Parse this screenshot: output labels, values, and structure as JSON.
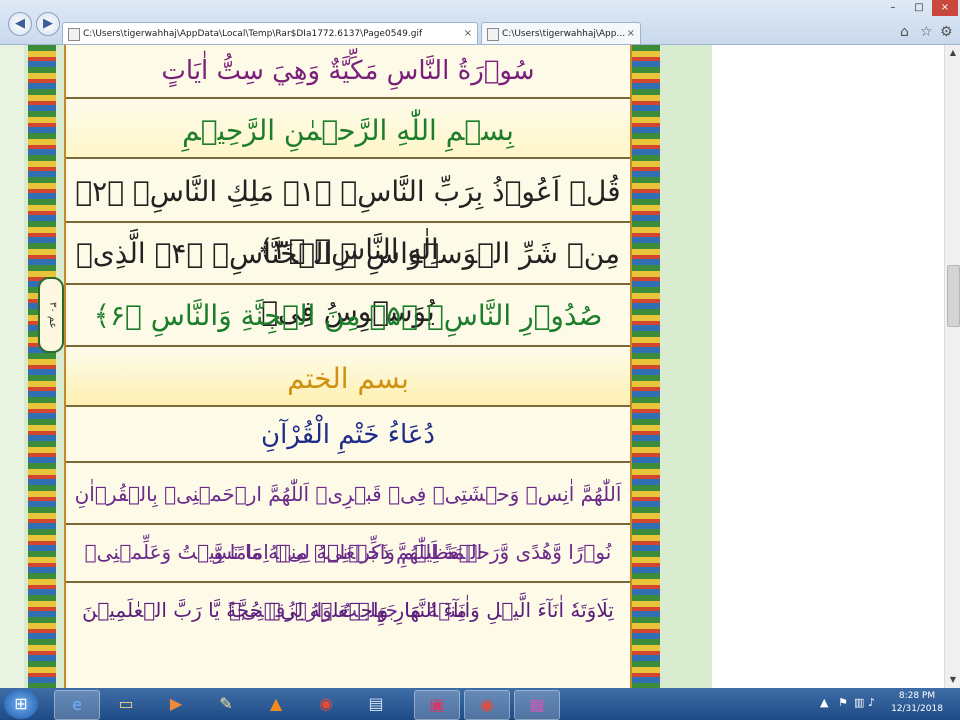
{
  "browser": {
    "back_icon": "back-arrow-icon",
    "forward_icon": "forward-arrow-icon",
    "tabs": [
      {
        "label": "C:\\Users\\tigerwahhaj\\AppData\\Local\\Temp\\Rar$DIa1772.6137\\Page0549.gif",
        "close": "×"
      },
      {
        "label": "C:\\Users\\tigerwahhaj\\App...",
        "close": "×"
      }
    ],
    "toolbar_icons": [
      "home-icon",
      "star-icon",
      "gear-icon"
    ],
    "window_controls": [
      "–",
      "□",
      "×"
    ]
  },
  "quran_page": {
    "surah_title": "سُوۡرَةُ النَّاسِ مَكِّيَّةٌ وَهِيَ سِتُّ اٰيَاتٍ",
    "bismillah": "بِسۡمِ اللّٰهِ الرَّحۡمٰنِ الرَّحِيۡمِ",
    "verses": [
      "قُلۡ اَعُوۡذُ بِرَبِّ النَّاسِۙ ﴿۱﴾ مَلِكِ النَّاسِۙ ﴿۲﴾ اِلٰهِ النَّاسِۙ ﴿۳﴾",
      "مِنۡ شَرِّ الۡوَسۡوَاسِ ۙ الۡخَنَّاسِۙ ﴿۴﴾ الَّذِىۡ يُوَسۡوِسُ فِىۡ",
      "صُدُوۡرِ النَّاسِۙ ﴿۵﴾ مِنَ الۡجِنَّةِ وَالنَّاسِ ﴿۶﴾"
    ],
    "khatm_label": "بسم الختم",
    "dua_title": "دُعَاءُ خَتْمِ الْقُرْآنِ",
    "dua_lines": [
      "اَللّٰهُمَّ اٰنِسۡ وَحۡشَتِىۡ فِىۡ قَبۡرِىۡ اَللّٰهُمَّ ارۡحَمۡنِىۡ بِالۡقُرۡاٰنِ الۡعَظِيۡمِ وَاجۡعَلۡهُ لِىۡ اِمَامًا وَّ",
      "نُوۡرًا وَّهُدًى وَّرَحۡمَةً اَللّٰهُمَّ ذَكِّرۡنِىۡ مِنۡهُ مَا نَسِيۡتُ وَعَلِّمۡنِىۡ مِنۡهُ مَا جَهِلۡتُ وَارۡزُقۡنِىۡ",
      "تِلَاوَتَهٗ اٰنَآءَ الَّيۡلِ وَاٰنَآءَ النَّهَارِ وَاجۡعَلۡهُ لِىۡ حُجَّةً يَّا رَبَّ الۡعٰلَمِيۡنَ"
    ],
    "juz_badge": "عم ٣٠"
  },
  "taskbar": {
    "start_icon": "windows-start-icon",
    "apps": [
      "internet-explorer-icon",
      "folder-icon",
      "media-player-icon",
      "paint-icon",
      "vlc-icon",
      "chrome-icon",
      "file-icon",
      "bag-icon",
      "chrome-icon",
      "winrar-icon"
    ],
    "clock_time": "8:28 PM",
    "clock_date": "12/31/2018"
  }
}
